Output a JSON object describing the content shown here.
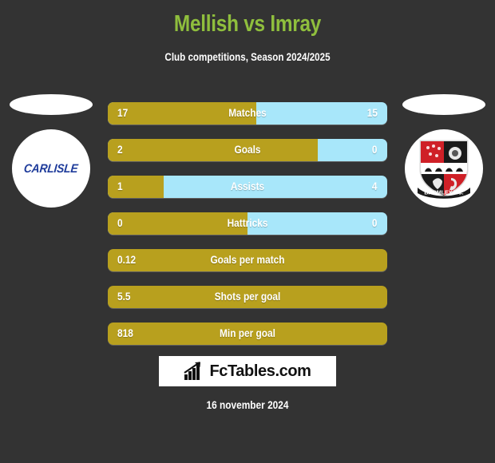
{
  "header": {
    "title": "Mellish vs Imray",
    "subtitle": "Club competitions, Season 2024/2025",
    "title_color": "#8fbe3d"
  },
  "teams": {
    "left": {
      "logo_name": "carlisle-logo",
      "logo_text": "CARLISLE",
      "logo_text_color": "#1f3c9b"
    },
    "right": {
      "logo_name": "bromley-fc-crest",
      "crest_banner_text": "BROMLEY F.C.",
      "crest_colors": [
        "#cf2027",
        "#1a1a1a",
        "#ffffff"
      ]
    }
  },
  "colors": {
    "background": "#333333",
    "home_bar": "#b8a01e",
    "away_bar": "#a8e7fa",
    "text": "#ffffff"
  },
  "chart_data": {
    "type": "bar",
    "title": "Mellish vs Imray",
    "subtitle": "Club competitions, Season 2024/2025",
    "orientation": "horizontal-split",
    "categories": [
      "Matches",
      "Goals",
      "Assists",
      "Hattricks",
      "Goals per match",
      "Shots per goal",
      "Min per goal"
    ],
    "series": [
      {
        "name": "Mellish",
        "color": "#b8a01e",
        "values": [
          "17",
          "2",
          "1",
          "0",
          "0.12",
          "5.5",
          "818"
        ]
      },
      {
        "name": "Imray",
        "color": "#a8e7fa",
        "values": [
          "15",
          "0",
          "4",
          "0",
          null,
          null,
          null
        ]
      }
    ],
    "rows": [
      {
        "label": "Matches",
        "left": "17",
        "right": "15",
        "fill_percent": 53.1,
        "split": true
      },
      {
        "label": "Goals",
        "left": "2",
        "right": "0",
        "fill_percent": 75.0,
        "split": true
      },
      {
        "label": "Assists",
        "left": "1",
        "right": "4",
        "fill_percent": 20.0,
        "split": true
      },
      {
        "label": "Hattricks",
        "left": "0",
        "right": "0",
        "fill_percent": 50.0,
        "split": true
      },
      {
        "label": "Goals per match",
        "left": "0.12",
        "right": "",
        "fill_percent": 100.0,
        "split": false
      },
      {
        "label": "Shots per goal",
        "left": "5.5",
        "right": "",
        "fill_percent": 100.0,
        "split": false
      },
      {
        "label": "Min per goal",
        "left": "818",
        "right": "",
        "fill_percent": 100.0,
        "split": false
      }
    ]
  },
  "branding": {
    "logo_text": "FcTables.com",
    "logo_icon": "bar-chart-icon"
  },
  "footer": {
    "date": "16 november 2024"
  }
}
